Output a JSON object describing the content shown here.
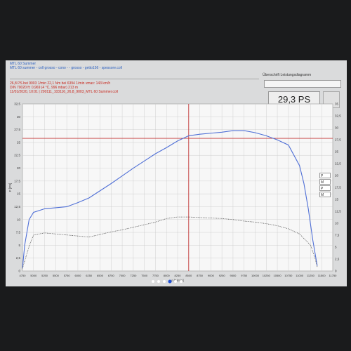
{
  "header": {
    "title_lines": [
      "MTL 60 Summer",
      "MTL 60 summer - coll grosso - cono - - grosso - getto156 - spessore.coll"
    ],
    "info_lines": [
      "26,8 PS bei 9003 1/min     22,1 Nm bei 6394 1/min     vmax: 143 km/h",
      "DIN 70020 ft: 0,969 (4 °C, 996 mbar)     213 m",
      "11/01/2020, 10:01 | 200111_103116_26,8_9003_MTL 60 Summer.coll"
    ]
  },
  "right_panel": {
    "heading": "Überschrift Leistungsdiagramm",
    "ps_value": "29,3 PS"
  },
  "legend": [
    "P",
    "M",
    "P",
    "M"
  ],
  "chart_data": {
    "type": "line",
    "xlabel": "n [1/min]",
    "ylabel": "P [PS]",
    "x_ticks": [
      4750,
      5000,
      5250,
      5500,
      5750,
      6000,
      6250,
      6500,
      6750,
      7000,
      7250,
      7500,
      7750,
      8000,
      8250,
      8500,
      8750,
      9000,
      9250,
      9500,
      9750,
      10000,
      10250,
      10500,
      10750,
      11000,
      11250,
      11500,
      11750
    ],
    "xlim": [
      4750,
      11750
    ],
    "ylim_left": [
      0,
      32.5
    ],
    "y_left_ticks": [
      0,
      2.5,
      5,
      7.5,
      10,
      12.5,
      15,
      17.5,
      20,
      22.5,
      25,
      27.5,
      30,
      32.5
    ],
    "ylim_right": [
      0,
      35
    ],
    "y_right_ticks": [
      0,
      2.5,
      5,
      7.5,
      10,
      12.5,
      15,
      17.5,
      20,
      22.5,
      25,
      27.5,
      30,
      32.5,
      35
    ],
    "grid": true,
    "crosshair": {
      "x": 8500,
      "y": 25.8
    },
    "series": [
      {
        "color": "#4f6fd6",
        "style": "solid",
        "x": [
          4750,
          4800,
          4900,
          5000,
          5250,
          5500,
          5750,
          6000,
          6250,
          6500,
          6750,
          7000,
          7250,
          7500,
          7750,
          8000,
          8250,
          8500,
          8750,
          9000,
          9250,
          9500,
          9750,
          10000,
          10250,
          10500,
          10750,
          11000,
          11100,
          11200,
          11300,
          11400
        ],
        "y": [
          0.5,
          5,
          10,
          11.4,
          12.1,
          12.3,
          12.5,
          13.3,
          14.2,
          15.6,
          17.0,
          18.5,
          20.0,
          21.4,
          22.8,
          24.0,
          25.3,
          26.3,
          26.6,
          26.8,
          27.0,
          27.3,
          27.3,
          26.9,
          26.3,
          25.5,
          24.5,
          20.5,
          17.0,
          12.0,
          6.0,
          1.0
        ]
      },
      {
        "color": "#555555",
        "style": "dotted",
        "x": [
          4750,
          4900,
          5000,
          5250,
          5500,
          5750,
          6000,
          6250,
          6500,
          6750,
          7000,
          7250,
          7500,
          7750,
          8000,
          8250,
          8500,
          8750,
          9000,
          9250,
          9500,
          9750,
          10000,
          10250,
          10500,
          10750,
          11000,
          11250,
          11350,
          11400
        ],
        "y": [
          0.5,
          4.8,
          7.0,
          7.4,
          7.2,
          7.0,
          6.8,
          6.6,
          7.1,
          7.6,
          8.0,
          8.5,
          9.0,
          9.5,
          10.2,
          10.5,
          10.5,
          10.4,
          10.3,
          10.2,
          10.0,
          9.7,
          9.5,
          9.2,
          8.8,
          8.2,
          7.2,
          5.0,
          2.5,
          0.8
        ]
      }
    ]
  }
}
